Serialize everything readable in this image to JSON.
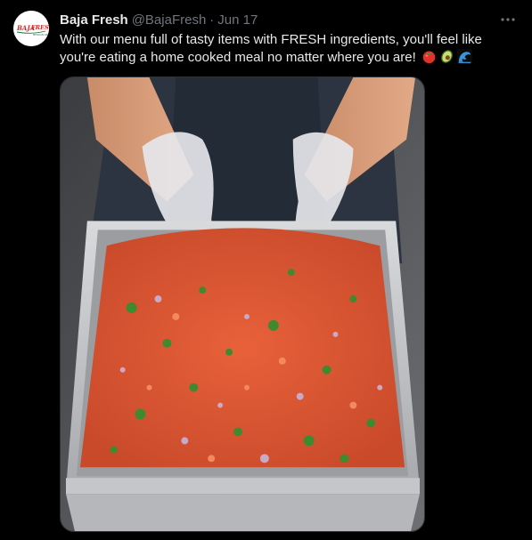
{
  "tweet": {
    "display_name": "Baja Fresh",
    "handle": "@BajaFresh",
    "separator": "·",
    "date": "Jun 17",
    "text": "With our menu full of tasty items with FRESH ingredients, you'll feel like you're eating a home cooked meal no matter where you are!",
    "emojis": [
      "tomato",
      "avocado",
      "water-wave"
    ],
    "avatar_logo_text": "BAJA FRESH",
    "more_icon": "ellipsis-icon"
  },
  "colors": {
    "background": "#000000",
    "primary_text": "#e7e9ea",
    "secondary_text": "#71767b",
    "avatar_red": "#d42a27"
  }
}
